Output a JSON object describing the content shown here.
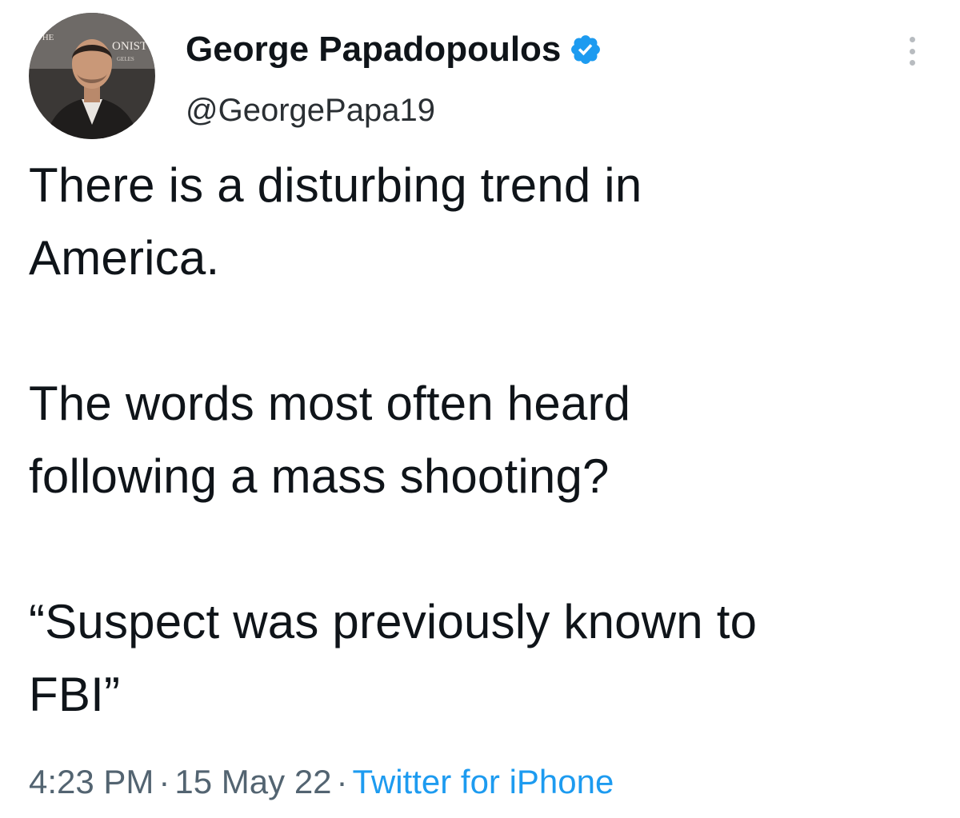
{
  "author": {
    "display_name": "George Papadopoulos",
    "handle": "@GeorgePapa19",
    "verified": true,
    "avatar_backdrop_text": [
      "THE",
      "ONIST",
      "GELES"
    ]
  },
  "icons": {
    "verified": "verified-check-badge",
    "more": "vertical-ellipsis"
  },
  "tweet": {
    "paragraphs": [
      [
        "There is a disturbing trend in",
        "America."
      ],
      [
        "The words most often heard",
        "following a mass shooting?"
      ],
      [
        "“Suspect was previously known to",
        "FBI”"
      ]
    ]
  },
  "meta": {
    "time": "4:23 PM",
    "separator": "·",
    "date": "15 May 22",
    "source": "Twitter for iPhone"
  },
  "colors": {
    "text": "#0f1419",
    "secondary": "#536471",
    "link": "#1d9bf0",
    "verified": "#1d9bf0"
  }
}
